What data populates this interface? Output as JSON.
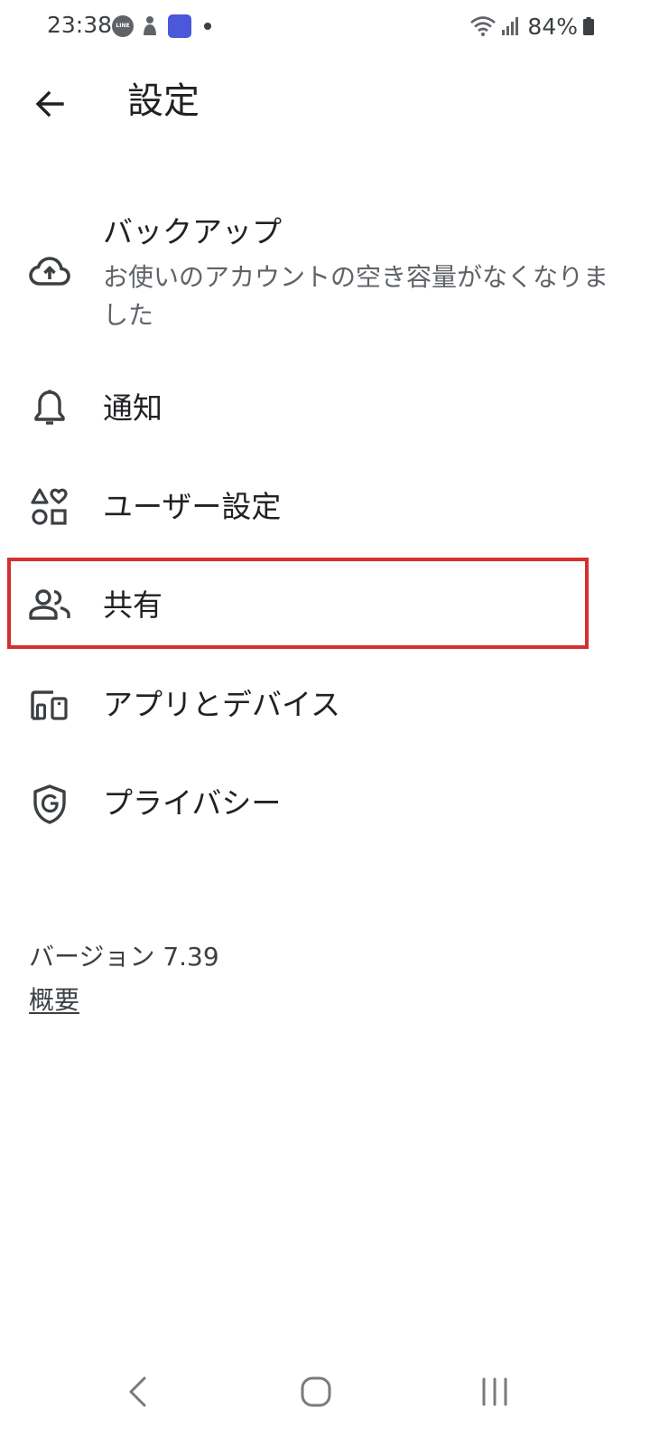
{
  "status_bar": {
    "time": "23:38",
    "line_badge": "LINE",
    "battery": "84%",
    "icons": [
      "line-icon",
      "person-icon",
      "app-icon",
      "dot-icon",
      "wifi-icon",
      "signal-icon",
      "battery-icon"
    ]
  },
  "app_bar": {
    "title": "設定",
    "back_icon": "arrow-left-icon"
  },
  "settings": {
    "items": [
      {
        "icon": "cloud-upload-icon",
        "title": "バックアップ",
        "subtitle": "お使いのアカウントの空き容量がなくなりました"
      },
      {
        "icon": "bell-icon",
        "title": "通知"
      },
      {
        "icon": "shapes-icon",
        "title": "ユーザー設定"
      },
      {
        "icon": "people-icon",
        "title": "共有"
      },
      {
        "icon": "devices-icon",
        "title": "アプリとデバイス"
      },
      {
        "icon": "shield-g-icon",
        "title": "プライバシー"
      }
    ]
  },
  "footer": {
    "version": "バージョン 7.39",
    "about": "概要"
  },
  "nav_bar": {
    "icons": [
      "back-nav-icon",
      "home-nav-icon",
      "recents-nav-icon"
    ]
  },
  "colors": {
    "highlight": "#d32f2f",
    "text_primary": "#202124",
    "text_secondary": "#5f6368"
  }
}
